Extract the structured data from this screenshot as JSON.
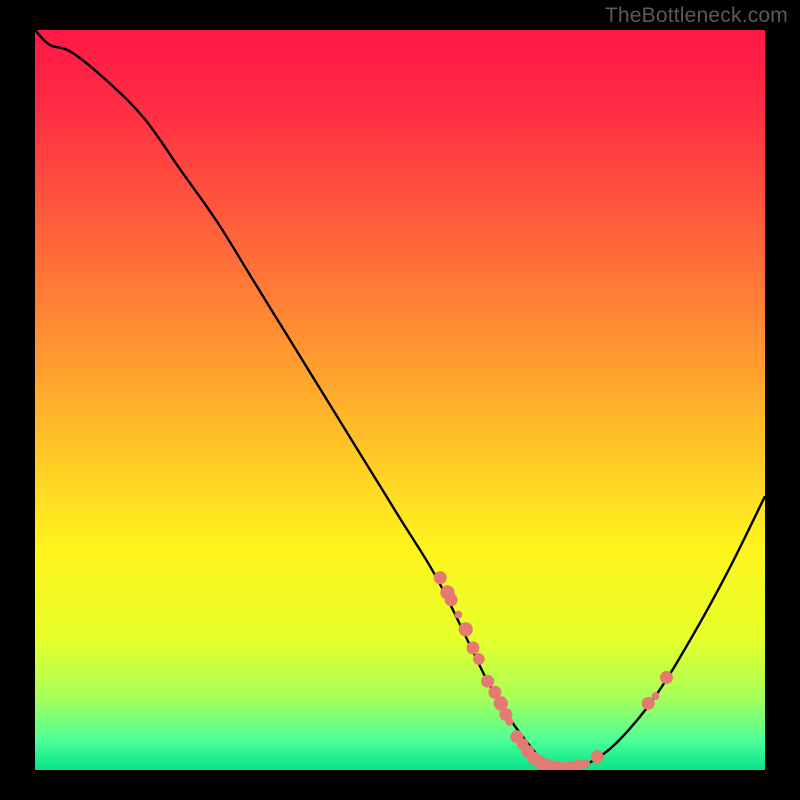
{
  "watermark": "TheBottleneck.com",
  "palette": {
    "background": "#000000",
    "curve_stroke": "#000000",
    "marker_fill": "#e47a70",
    "gradient_stops": [
      {
        "offset": 0.0,
        "color": "#ff1846"
      },
      {
        "offset": 0.1,
        "color": "#ff2b44"
      },
      {
        "offset": 0.25,
        "color": "#ff5a3b"
      },
      {
        "offset": 0.4,
        "color": "#ff8b33"
      },
      {
        "offset": 0.55,
        "color": "#ffc027"
      },
      {
        "offset": 0.7,
        "color": "#fff41c"
      },
      {
        "offset": 0.82,
        "color": "#e7ff2a"
      },
      {
        "offset": 0.9,
        "color": "#a9ff57"
      },
      {
        "offset": 0.96,
        "color": "#4dff97"
      },
      {
        "offset": 1.0,
        "color": "#06e38a"
      }
    ]
  },
  "chart_data": {
    "type": "line",
    "title": "",
    "xlabel": "",
    "ylabel": "",
    "xlim": [
      0,
      100
    ],
    "ylim": [
      0,
      100
    ],
    "x": [
      0,
      2,
      5,
      10,
      15,
      20,
      25,
      30,
      35,
      40,
      45,
      50,
      55,
      60,
      62,
      65,
      68,
      70,
      73,
      76,
      80,
      85,
      90,
      95,
      100
    ],
    "y": [
      100,
      98,
      97,
      93,
      88,
      81,
      74,
      66,
      58,
      50,
      42,
      34,
      26,
      16,
      12,
      7,
      3,
      1,
      0,
      1,
      4,
      10,
      18,
      27,
      37
    ],
    "markers": [
      {
        "x": 55.5,
        "y": 26.0,
        "r": 1.0
      },
      {
        "x": 56.5,
        "y": 24.0,
        "r": 1.1
      },
      {
        "x": 57.0,
        "y": 23.0,
        "r": 1.0
      },
      {
        "x": 58.0,
        "y": 21.0,
        "r": 0.6
      },
      {
        "x": 59.0,
        "y": 19.0,
        "r": 1.1
      },
      {
        "x": 60.0,
        "y": 16.5,
        "r": 1.0
      },
      {
        "x": 60.8,
        "y": 15.0,
        "r": 0.9
      },
      {
        "x": 62.0,
        "y": 12.0,
        "r": 1.0
      },
      {
        "x": 63.0,
        "y": 10.5,
        "r": 1.0
      },
      {
        "x": 63.8,
        "y": 9.0,
        "r": 1.1
      },
      {
        "x": 64.5,
        "y": 7.5,
        "r": 1.0
      },
      {
        "x": 65.0,
        "y": 6.5,
        "r": 0.6
      },
      {
        "x": 66.0,
        "y": 4.5,
        "r": 1.0
      },
      {
        "x": 66.8,
        "y": 3.5,
        "r": 0.9
      },
      {
        "x": 67.5,
        "y": 2.5,
        "r": 1.0
      },
      {
        "x": 68.3,
        "y": 1.6,
        "r": 1.0
      },
      {
        "x": 69.3,
        "y": 1.0,
        "r": 1.0
      },
      {
        "x": 70.3,
        "y": 0.6,
        "r": 1.0
      },
      {
        "x": 71.3,
        "y": 0.4,
        "r": 1.0
      },
      {
        "x": 72.3,
        "y": 0.3,
        "r": 0.9
      },
      {
        "x": 73.3,
        "y": 0.3,
        "r": 1.0
      },
      {
        "x": 74.5,
        "y": 0.6,
        "r": 0.9
      },
      {
        "x": 75.5,
        "y": 0.9,
        "r": 0.6
      },
      {
        "x": 77.0,
        "y": 1.8,
        "r": 1.0
      },
      {
        "x": 84.0,
        "y": 9.0,
        "r": 1.0
      },
      {
        "x": 85.0,
        "y": 10.0,
        "r": 0.6
      },
      {
        "x": 86.5,
        "y": 12.5,
        "r": 1.0
      }
    ]
  }
}
